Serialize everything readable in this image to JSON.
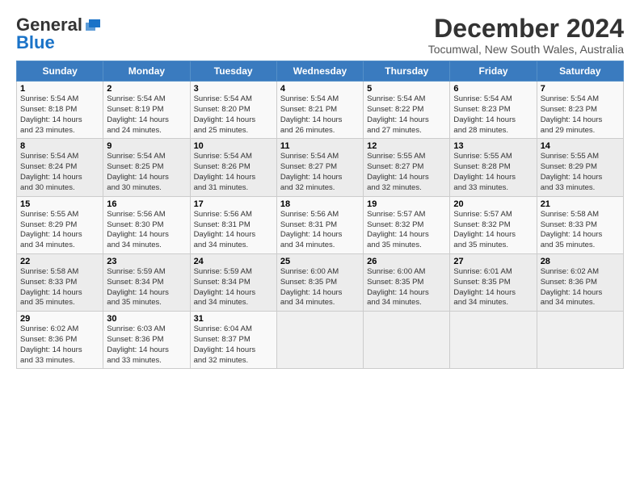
{
  "logo": {
    "line1": "General",
    "line2": "Blue"
  },
  "title": "December 2024",
  "subtitle": "Tocumwal, New South Wales, Australia",
  "weekdays": [
    "Sunday",
    "Monday",
    "Tuesday",
    "Wednesday",
    "Thursday",
    "Friday",
    "Saturday"
  ],
  "weeks": [
    [
      {
        "day": "1",
        "info": "Sunrise: 5:54 AM\nSunset: 8:18 PM\nDaylight: 14 hours\nand 23 minutes."
      },
      {
        "day": "2",
        "info": "Sunrise: 5:54 AM\nSunset: 8:19 PM\nDaylight: 14 hours\nand 24 minutes."
      },
      {
        "day": "3",
        "info": "Sunrise: 5:54 AM\nSunset: 8:20 PM\nDaylight: 14 hours\nand 25 minutes."
      },
      {
        "day": "4",
        "info": "Sunrise: 5:54 AM\nSunset: 8:21 PM\nDaylight: 14 hours\nand 26 minutes."
      },
      {
        "day": "5",
        "info": "Sunrise: 5:54 AM\nSunset: 8:22 PM\nDaylight: 14 hours\nand 27 minutes."
      },
      {
        "day": "6",
        "info": "Sunrise: 5:54 AM\nSunset: 8:23 PM\nDaylight: 14 hours\nand 28 minutes."
      },
      {
        "day": "7",
        "info": "Sunrise: 5:54 AM\nSunset: 8:23 PM\nDaylight: 14 hours\nand 29 minutes."
      }
    ],
    [
      {
        "day": "8",
        "info": "Sunrise: 5:54 AM\nSunset: 8:24 PM\nDaylight: 14 hours\nand 30 minutes."
      },
      {
        "day": "9",
        "info": "Sunrise: 5:54 AM\nSunset: 8:25 PM\nDaylight: 14 hours\nand 30 minutes."
      },
      {
        "day": "10",
        "info": "Sunrise: 5:54 AM\nSunset: 8:26 PM\nDaylight: 14 hours\nand 31 minutes."
      },
      {
        "day": "11",
        "info": "Sunrise: 5:54 AM\nSunset: 8:27 PM\nDaylight: 14 hours\nand 32 minutes."
      },
      {
        "day": "12",
        "info": "Sunrise: 5:55 AM\nSunset: 8:27 PM\nDaylight: 14 hours\nand 32 minutes."
      },
      {
        "day": "13",
        "info": "Sunrise: 5:55 AM\nSunset: 8:28 PM\nDaylight: 14 hours\nand 33 minutes."
      },
      {
        "day": "14",
        "info": "Sunrise: 5:55 AM\nSunset: 8:29 PM\nDaylight: 14 hours\nand 33 minutes."
      }
    ],
    [
      {
        "day": "15",
        "info": "Sunrise: 5:55 AM\nSunset: 8:29 PM\nDaylight: 14 hours\nand 34 minutes."
      },
      {
        "day": "16",
        "info": "Sunrise: 5:56 AM\nSunset: 8:30 PM\nDaylight: 14 hours\nand 34 minutes."
      },
      {
        "day": "17",
        "info": "Sunrise: 5:56 AM\nSunset: 8:31 PM\nDaylight: 14 hours\nand 34 minutes."
      },
      {
        "day": "18",
        "info": "Sunrise: 5:56 AM\nSunset: 8:31 PM\nDaylight: 14 hours\nand 34 minutes."
      },
      {
        "day": "19",
        "info": "Sunrise: 5:57 AM\nSunset: 8:32 PM\nDaylight: 14 hours\nand 35 minutes."
      },
      {
        "day": "20",
        "info": "Sunrise: 5:57 AM\nSunset: 8:32 PM\nDaylight: 14 hours\nand 35 minutes."
      },
      {
        "day": "21",
        "info": "Sunrise: 5:58 AM\nSunset: 8:33 PM\nDaylight: 14 hours\nand 35 minutes."
      }
    ],
    [
      {
        "day": "22",
        "info": "Sunrise: 5:58 AM\nSunset: 8:33 PM\nDaylight: 14 hours\nand 35 minutes."
      },
      {
        "day": "23",
        "info": "Sunrise: 5:59 AM\nSunset: 8:34 PM\nDaylight: 14 hours\nand 35 minutes."
      },
      {
        "day": "24",
        "info": "Sunrise: 5:59 AM\nSunset: 8:34 PM\nDaylight: 14 hours\nand 34 minutes."
      },
      {
        "day": "25",
        "info": "Sunrise: 6:00 AM\nSunset: 8:35 PM\nDaylight: 14 hours\nand 34 minutes."
      },
      {
        "day": "26",
        "info": "Sunrise: 6:00 AM\nSunset: 8:35 PM\nDaylight: 14 hours\nand 34 minutes."
      },
      {
        "day": "27",
        "info": "Sunrise: 6:01 AM\nSunset: 8:35 PM\nDaylight: 14 hours\nand 34 minutes."
      },
      {
        "day": "28",
        "info": "Sunrise: 6:02 AM\nSunset: 8:36 PM\nDaylight: 14 hours\nand 34 minutes."
      }
    ],
    [
      {
        "day": "29",
        "info": "Sunrise: 6:02 AM\nSunset: 8:36 PM\nDaylight: 14 hours\nand 33 minutes."
      },
      {
        "day": "30",
        "info": "Sunrise: 6:03 AM\nSunset: 8:36 PM\nDaylight: 14 hours\nand 33 minutes."
      },
      {
        "day": "31",
        "info": "Sunrise: 6:04 AM\nSunset: 8:37 PM\nDaylight: 14 hours\nand 32 minutes."
      },
      {
        "day": "",
        "info": ""
      },
      {
        "day": "",
        "info": ""
      },
      {
        "day": "",
        "info": ""
      },
      {
        "day": "",
        "info": ""
      }
    ]
  ]
}
